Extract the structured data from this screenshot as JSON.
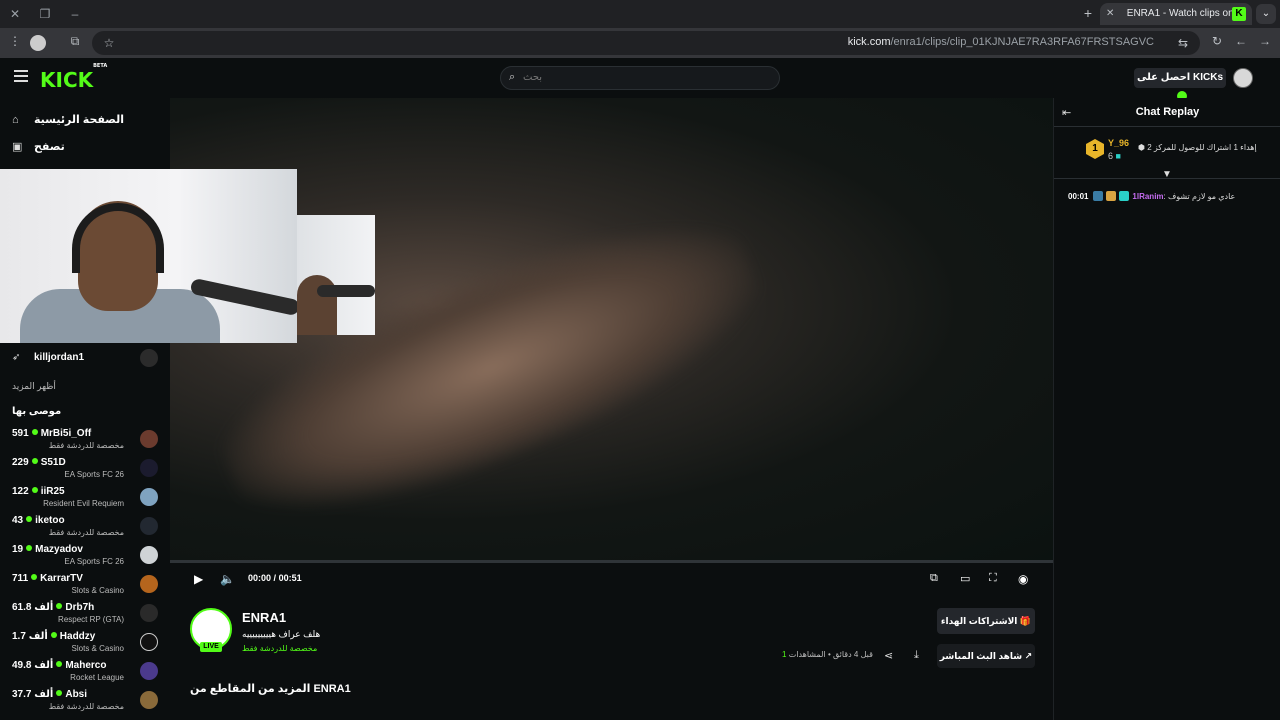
{
  "browser": {
    "tab_title": "ENRA1 - Watch clips on Kick",
    "url_domain": "kick.com",
    "url_path": "/enra1/clips/clip_01KJNJAE7RA3RFA67FRSTSAGVC"
  },
  "header": {
    "logo": "KICK",
    "logo_badge": "BETA",
    "search_placeholder": "بحث",
    "kicks_label": "احصل على KICKs"
  },
  "sidebar": {
    "home_label": "الصفحة الرئيسية",
    "browse_label": "تصفح",
    "following_user": "killjordan1",
    "show_more": "أظهر المزيد",
    "recommended_title": "موصى بها",
    "channels": [
      {
        "name": "MrBi5i_Off",
        "viewers": "591",
        "category": "مخصصة للدردشة فقط",
        "avatar_color": "#6b3b2e"
      },
      {
        "name": "S51D",
        "viewers": "229",
        "category": "EA Sports FC 26",
        "avatar_color": "#1b1b2e"
      },
      {
        "name": "iiR25",
        "viewers": "122",
        "category": "Resident Evil Requiem",
        "avatar_color": "#7fa3c0"
      },
      {
        "name": "iketoo",
        "viewers": "43",
        "category": "مخصصة للدردشة فقط",
        "avatar_color": "#222831"
      },
      {
        "name": "Mazyadov",
        "viewers": "19",
        "category": "EA Sports FC 26",
        "avatar_color": "#cfd3d6"
      },
      {
        "name": "KarrarTV",
        "viewers": "711",
        "category": "Slots & Casino",
        "avatar_color": "#b5651d"
      },
      {
        "name": "Drb7h",
        "viewers": "61.8 ألف",
        "category": "Respect RP (GTA)",
        "avatar_color": "#2a2a2a"
      },
      {
        "name": "Haddzy",
        "viewers": "1.7 ألف",
        "category": "Slots & Casino",
        "avatar_color": "#111111"
      },
      {
        "name": "Maherco",
        "viewers": "49.8 ألف",
        "category": "Rocket League",
        "avatar_color": "#4b3a8c"
      },
      {
        "name": "Absi",
        "viewers": "37.7 ألف",
        "category": "مخصصة للدردشة فقط",
        "avatar_color": "#8a6a3a"
      }
    ]
  },
  "player": {
    "current_time": "00:00",
    "separator": "/",
    "duration": "00:51",
    "progress": 0.0
  },
  "clip": {
    "channel_name": "ENRA1",
    "title": "هلف عراف هيييييييييه",
    "category": "مخصصة للدردشة فقط",
    "live_badge": "LIVE",
    "gift_button": "الاشتراكات الهداء",
    "watch_live_button": "شاهد البث المباشر",
    "time_ago": "قبل 4 دقائق",
    "views_label": "المشاهدات",
    "views_count": "1",
    "more_clips": "المزيد من المقاطع من ENRA1"
  },
  "chat": {
    "title": "Chat Replay",
    "pinned": {
      "rank": "1",
      "user": "Y_96",
      "count": "6",
      "text": "إهداء 1 اشتراك للوصول للمركز 2"
    },
    "messages": [
      {
        "time": "00:01",
        "user": "1lRanim",
        "text": "عادي مو لازم تشوف"
      }
    ]
  },
  "colors": {
    "accent": "#53fc18",
    "background": "#0b0e0f"
  }
}
